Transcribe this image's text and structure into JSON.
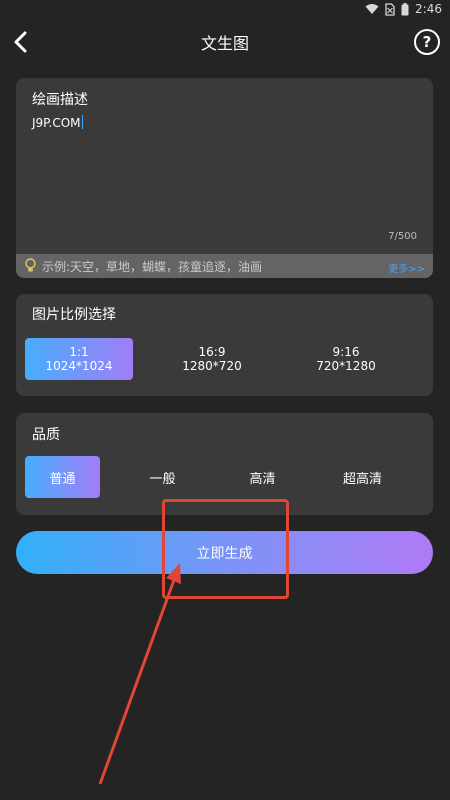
{
  "status": {
    "time": "2:46"
  },
  "header": {
    "title": "文生图",
    "help_symbol": "?"
  },
  "description": {
    "label": "绘画描述",
    "value": "J9P.COM",
    "counter": "7/500",
    "hint": "示例:天空，草地，蝴蝶，孩童追逐，油画",
    "more_label": "更多>>"
  },
  "ratio": {
    "label": "图片比例选择",
    "options": [
      {
        "ratio": "1:1",
        "size": "1024*1024",
        "selected": true
      },
      {
        "ratio": "16:9",
        "size": "1280*720",
        "selected": false
      },
      {
        "ratio": "9:16",
        "size": "720*1280",
        "selected": false
      }
    ]
  },
  "quality": {
    "label": "品质",
    "options": [
      {
        "label": "普通",
        "selected": true
      },
      {
        "label": "一般",
        "selected": false
      },
      {
        "label": "高清",
        "selected": false
      },
      {
        "label": "超高清",
        "selected": false
      }
    ]
  },
  "generate_button": {
    "label": "立即生成"
  },
  "colors": {
    "accent_start": "#46aefc",
    "accent_end": "#a27cf6",
    "annotation": "#e04536"
  }
}
